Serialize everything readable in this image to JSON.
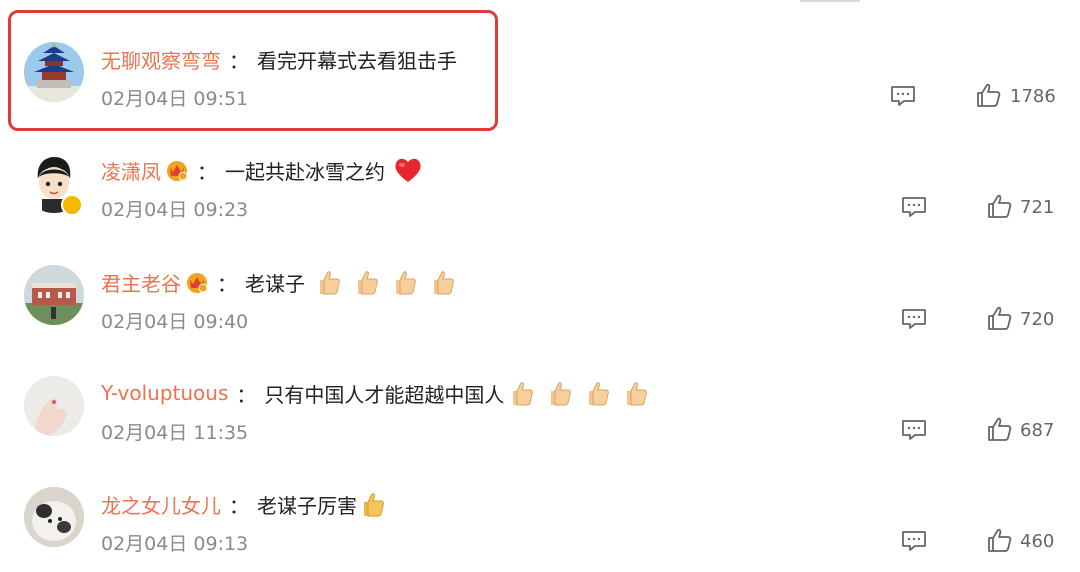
{
  "comments": [
    {
      "username": "无聊观察弯弯",
      "colon": "：",
      "text": "看完开幕式去看狙击手",
      "time": "02月04日 09:51",
      "likes": "1786",
      "avatar": "temple-of-heaven-avatar",
      "badge": null,
      "emoji": [],
      "highlighted": true
    },
    {
      "username": "凌潇凤",
      "colon": "：",
      "text": "一起共赴冰雪之约",
      "time": "02月04日 09:23",
      "likes": "721",
      "avatar": "cartoon-boy-avatar",
      "badge": "crown-badge",
      "emoji": [
        "red-heart-emoji"
      ],
      "verified": true
    },
    {
      "username": "君主老谷",
      "colon": "：",
      "text": "老谋子",
      "time": "02月04日 09:40",
      "likes": "720",
      "avatar": "building-photo-avatar",
      "badge": "crown-badge",
      "emoji": [
        "thumbs-up-emoji",
        "thumbs-up-emoji",
        "thumbs-up-emoji",
        "thumbs-up-emoji"
      ]
    },
    {
      "username": "Y-voluptuous",
      "colon": "：",
      "text": "只有中国人才能超越中国人",
      "time": "02月04日 11:35",
      "likes": "687",
      "avatar": "hand-photo-avatar",
      "badge": null,
      "emoji": [
        "thumbs-up-emoji",
        "thumbs-up-emoji",
        "thumbs-up-emoji",
        "thumbs-up-emoji"
      ]
    },
    {
      "username": "龙之女儿女儿",
      "colon": "：",
      "text": "老谋子厉害",
      "time": "02月04日 09:13",
      "likes": "460",
      "avatar": "cat-photo-avatar",
      "badge": null,
      "emoji": [
        "thumbs-up-emoji"
      ]
    }
  ],
  "colors": {
    "username": "#eb7350",
    "highlight_border": "#e23b35",
    "timestamp": "#8a8a8a"
  },
  "icons": {
    "reply": "comment-reply-icon",
    "like": "thumbs-up-like-icon"
  }
}
